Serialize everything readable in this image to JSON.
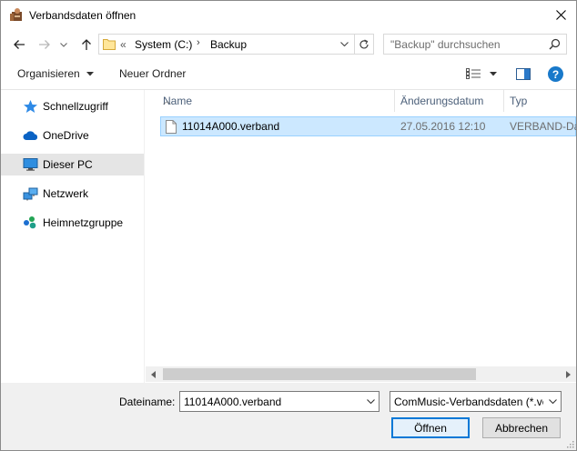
{
  "window": {
    "title": "Verbandsdaten öffnen",
    "app_icon": "app-icon",
    "close_icon": "close-icon"
  },
  "nav": {
    "back_icon": "arrow-left-icon",
    "forward_icon": "arrow-right-icon",
    "recent_icon": "chevron-down-icon",
    "up_icon": "arrow-up-icon"
  },
  "address": {
    "overflow": "«",
    "parts": [
      "System (C:)",
      "Backup"
    ],
    "separator": "›",
    "refresh_icon": "refresh-icon"
  },
  "search": {
    "placeholder": "\"Backup\" durchsuchen",
    "icon": "search-icon"
  },
  "toolbar": {
    "organize_label": "Organisieren",
    "new_folder_label": "Neuer Ordner",
    "view_icon": "view-details-icon",
    "preview_icon": "preview-pane-icon",
    "help_icon": "help-icon"
  },
  "sidebar": {
    "items": [
      {
        "label": "Schnellzugriff",
        "icon": "star-icon",
        "selected": false
      },
      {
        "label": "OneDrive",
        "icon": "cloud-icon",
        "selected": false
      },
      {
        "label": "Dieser PC",
        "icon": "computer-icon",
        "selected": true
      },
      {
        "label": "Netzwerk",
        "icon": "network-icon",
        "selected": false
      },
      {
        "label": "Heimnetzgruppe",
        "icon": "homegroup-icon",
        "selected": false
      }
    ]
  },
  "filelist": {
    "columns": [
      "Name",
      "Änderungsdatum",
      "Typ"
    ],
    "rows": [
      {
        "name": "11014A000.verband",
        "date": "27.05.2016 12:10",
        "type": "VERBAND-Dat",
        "selected": true
      }
    ]
  },
  "bottom": {
    "filename_label": "Dateiname:",
    "filename_value": "11014A000.verband",
    "filter_value": "ComMusic-Verbandsdaten (*.ver",
    "open_label": "Öffnen",
    "cancel_label": "Abbrechen"
  },
  "colors": {
    "selection_bg": "#cce8ff",
    "selection_border": "#99d1ff",
    "accent": "#0078d7",
    "help": "#1979ca"
  }
}
